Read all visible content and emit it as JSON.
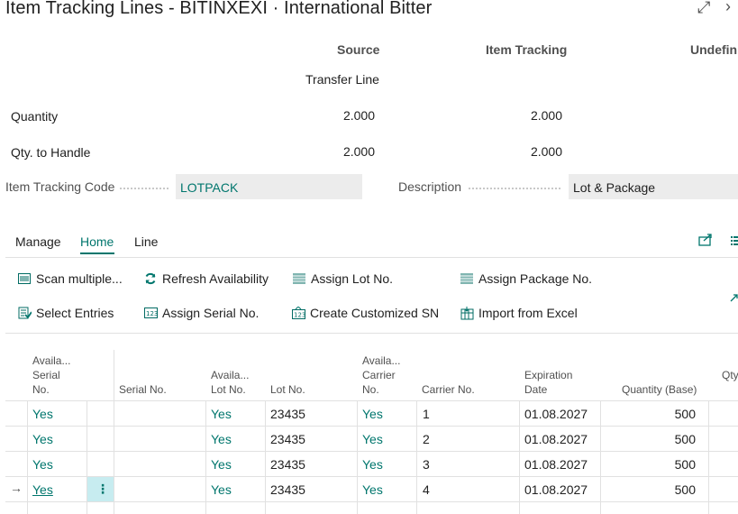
{
  "window": {
    "title": "Item Tracking Lines - BITINXEXI · International Bitter",
    "expand_icon": "expand-icon",
    "next_icon": "chevron-right-icon"
  },
  "summary": {
    "col_source": "Source",
    "col_item_tracking": "Item Tracking",
    "col_undefined": "Undefin",
    "source_subtitle": "Transfer Line",
    "rows": [
      {
        "label": "Quantity",
        "source": "2.000",
        "item_tracking": "2.000"
      },
      {
        "label": "Qty. to Handle",
        "source": "2.000",
        "item_tracking": "2.000"
      }
    ]
  },
  "fields": {
    "item_tracking_code_label": "Item Tracking Code",
    "item_tracking_code_value": "LOTPACK",
    "description_label": "Description",
    "description_value": "Lot & Package"
  },
  "tabs": {
    "manage": "Manage",
    "home": "Home",
    "line": "Line",
    "active": "Home"
  },
  "actions": {
    "scan_multiple": "Scan multiple...",
    "refresh_availability": "Refresh Availability",
    "assign_lot_no": "Assign Lot No.",
    "assign_package_no": "Assign Package No.",
    "select_entries": "Select Entries",
    "assign_serial_no": "Assign Serial No.",
    "create_customized_sn": "Create Customized SN",
    "import_from_excel": "Import from Excel"
  },
  "grid": {
    "headers": {
      "avail_serial_1": "Availa...",
      "avail_serial_2": "Serial",
      "avail_serial_3": "No.",
      "serial_no": "Serial No.",
      "avail_lot_1": "Availa...",
      "avail_lot_2": "Lot No.",
      "lot_no": "Lot No.",
      "avail_carrier_1": "Availa...",
      "avail_carrier_2": "Carrier",
      "avail_carrier_3": "No.",
      "carrier_no": "Carrier No.",
      "exp_1": "Expiration",
      "exp_2": "Date",
      "qty_base": "Quantity (Base)",
      "qty_partial": "Qty"
    },
    "rows": [
      {
        "avail_serial": "Yes",
        "serial_no": "",
        "avail_lot": "Yes",
        "lot_no": "23435",
        "avail_carrier": "Yes",
        "carrier_no": "1",
        "expiration": "01.08.2027",
        "qty_base": "500"
      },
      {
        "avail_serial": "Yes",
        "serial_no": "",
        "avail_lot": "Yes",
        "lot_no": "23435",
        "avail_carrier": "Yes",
        "carrier_no": "2",
        "expiration": "01.08.2027",
        "qty_base": "500"
      },
      {
        "avail_serial": "Yes",
        "serial_no": "",
        "avail_lot": "Yes",
        "lot_no": "23435",
        "avail_carrier": "Yes",
        "carrier_no": "3",
        "expiration": "01.08.2027",
        "qty_base": "500"
      },
      {
        "avail_serial": "Yes",
        "serial_no": "",
        "avail_lot": "Yes",
        "lot_no": "23435",
        "avail_carrier": "Yes",
        "carrier_no": "4",
        "expiration": "01.08.2027",
        "qty_base": "500"
      }
    ],
    "current_row_marker": "→",
    "row_menu_glyph": "⋮"
  },
  "colors": {
    "accent": "#00766d",
    "selected_cell": "#c7ecf0",
    "field_bg": "#ececec"
  }
}
